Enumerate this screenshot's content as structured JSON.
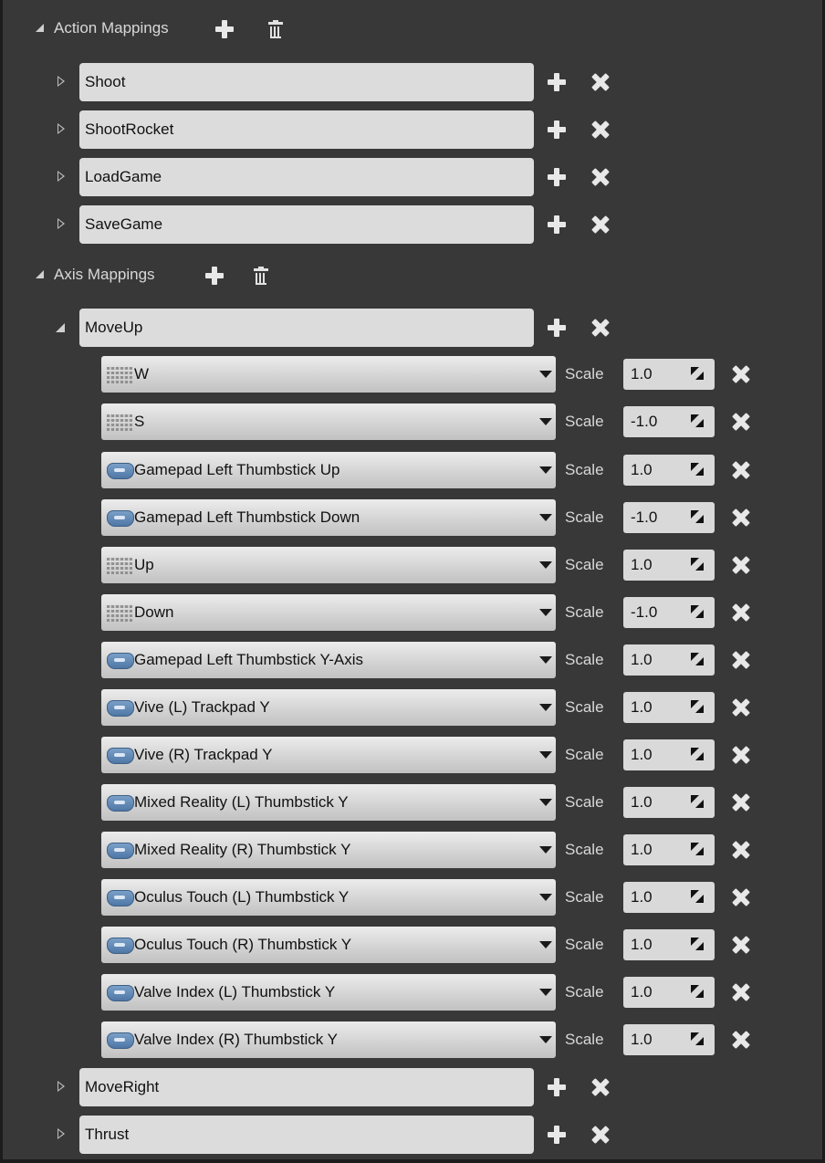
{
  "action_mappings": {
    "label": "Action Mappings",
    "items": [
      {
        "name": "Shoot"
      },
      {
        "name": "ShootRocket"
      },
      {
        "name": "LoadGame"
      },
      {
        "name": "SaveGame"
      }
    ]
  },
  "axis_mappings": {
    "label": "Axis Mappings",
    "moveup": {
      "name": "MoveUp",
      "scale_label": "Scale",
      "keys": [
        {
          "key": "W",
          "icon": "keyboard-icon",
          "scale": "1.0"
        },
        {
          "key": "S",
          "icon": "keyboard-icon",
          "scale": "-1.0"
        },
        {
          "key": "Gamepad Left Thumbstick Up",
          "icon": "gamepad-icon",
          "scale": "1.0"
        },
        {
          "key": "Gamepad Left Thumbstick Down",
          "icon": "gamepad-icon",
          "scale": "-1.0"
        },
        {
          "key": "Up",
          "icon": "keyboard-icon",
          "scale": "1.0"
        },
        {
          "key": "Down",
          "icon": "keyboard-icon",
          "scale": "-1.0"
        },
        {
          "key": "Gamepad Left Thumbstick Y-Axis",
          "icon": "gamepad-icon",
          "scale": "1.0"
        },
        {
          "key": "Vive (L) Trackpad Y",
          "icon": "gamepad-icon",
          "scale": "1.0"
        },
        {
          "key": "Vive (R) Trackpad Y",
          "icon": "gamepad-icon",
          "scale": "1.0"
        },
        {
          "key": "Mixed Reality (L) Thumbstick Y",
          "icon": "gamepad-icon",
          "scale": "1.0"
        },
        {
          "key": "Mixed Reality (R) Thumbstick Y",
          "icon": "gamepad-icon",
          "scale": "1.0"
        },
        {
          "key": "Oculus Touch (L) Thumbstick Y",
          "icon": "gamepad-icon",
          "scale": "1.0"
        },
        {
          "key": "Oculus Touch (R) Thumbstick Y",
          "icon": "gamepad-icon",
          "scale": "1.0"
        },
        {
          "key": "Valve Index (L) Thumbstick Y",
          "icon": "gamepad-icon",
          "scale": "1.0"
        },
        {
          "key": "Valve Index (R) Thumbstick Y",
          "icon": "gamepad-icon",
          "scale": "1.0"
        }
      ]
    },
    "collapsed": [
      {
        "name": "MoveRight"
      },
      {
        "name": "Thrust"
      }
    ]
  },
  "colors": {
    "panel_bg": "#383838",
    "field_bg": "#dcdcdc",
    "icon_light": "#e8e8e8"
  }
}
